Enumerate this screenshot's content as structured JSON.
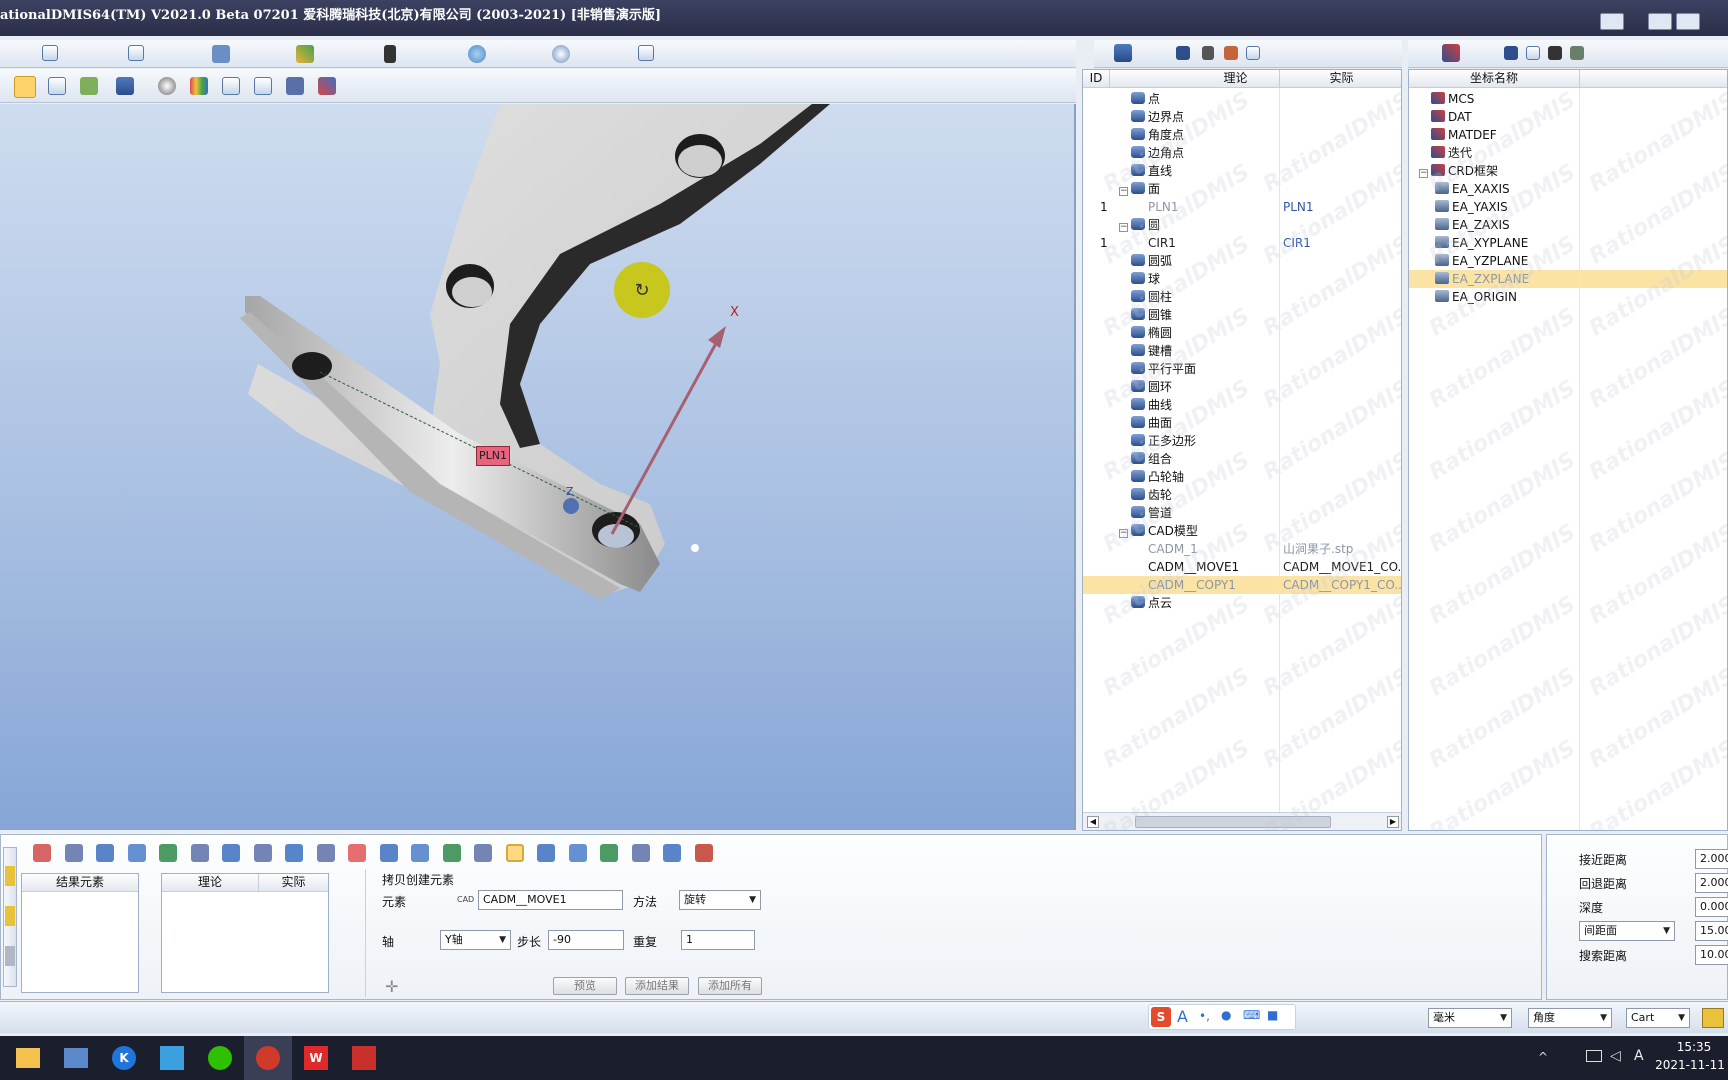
{
  "window": {
    "title": "ationalDMIS64(TM) V2021.0 Beta 07201   爱科腾瑞科技(北京)有限公司 (2003-2021) [非销售演示版]"
  },
  "viewport": {
    "plane_label": "PLN1",
    "axis_x_label": "X",
    "axis_z_label": "Z"
  },
  "feature_tree": {
    "headers": [
      "ID",
      "理论",
      "实际"
    ],
    "rows": [
      {
        "id": "",
        "name": "点",
        "actual": "",
        "icon": "point-icon",
        "level": 1
      },
      {
        "id": "",
        "name": "边界点",
        "actual": "",
        "icon": "edge-point-icon",
        "level": 1
      },
      {
        "id": "",
        "name": "角度点",
        "actual": "",
        "icon": "angle-point-icon",
        "level": 1
      },
      {
        "id": "",
        "name": "边角点",
        "actual": "",
        "icon": "corner-point-icon",
        "level": 1
      },
      {
        "id": "",
        "name": "直线",
        "actual": "",
        "icon": "line-icon",
        "level": 1
      },
      {
        "id": "",
        "name": "面",
        "actual": "",
        "icon": "plane-icon",
        "level": 1,
        "expanded": true
      },
      {
        "id": "1",
        "name": "PLN1",
        "actual": "PLN1",
        "icon": "",
        "level": 2,
        "dim": true
      },
      {
        "id": "",
        "name": "圆",
        "actual": "",
        "icon": "circle-icon",
        "level": 1,
        "expanded": true
      },
      {
        "id": "1",
        "name": "CIR1",
        "actual": "CIR1",
        "icon": "",
        "level": 2
      },
      {
        "id": "",
        "name": "圆弧",
        "actual": "",
        "icon": "arc-icon",
        "level": 1
      },
      {
        "id": "",
        "name": "球",
        "actual": "",
        "icon": "sphere-icon",
        "level": 1
      },
      {
        "id": "",
        "name": "圆柱",
        "actual": "",
        "icon": "cylinder-icon",
        "level": 1
      },
      {
        "id": "",
        "name": "圆锥",
        "actual": "",
        "icon": "cone-icon",
        "level": 1
      },
      {
        "id": "",
        "name": "椭圆",
        "actual": "",
        "icon": "ellipse-icon",
        "level": 1
      },
      {
        "id": "",
        "name": "键槽",
        "actual": "",
        "icon": "slot-icon",
        "level": 1
      },
      {
        "id": "",
        "name": "平行平面",
        "actual": "",
        "icon": "parallel-plane-icon",
        "level": 1
      },
      {
        "id": "",
        "name": "圆环",
        "actual": "",
        "icon": "torus-icon",
        "level": 1
      },
      {
        "id": "",
        "name": "曲线",
        "actual": "",
        "icon": "curve-icon",
        "level": 1
      },
      {
        "id": "",
        "name": "曲面",
        "actual": "",
        "icon": "surface-icon",
        "level": 1
      },
      {
        "id": "",
        "name": "正多边形",
        "actual": "",
        "icon": "polygon-icon",
        "level": 1
      },
      {
        "id": "",
        "name": "组合",
        "actual": "",
        "icon": "compound-icon",
        "level": 1
      },
      {
        "id": "",
        "name": "凸轮轴",
        "actual": "",
        "icon": "camshaft-icon",
        "level": 1
      },
      {
        "id": "",
        "name": "齿轮",
        "actual": "",
        "icon": "gear-icon",
        "level": 1
      },
      {
        "id": "",
        "name": "管道",
        "actual": "",
        "icon": "pipe-icon",
        "level": 1
      },
      {
        "id": "",
        "name": "CAD模型",
        "actual": "",
        "icon": "cad-icon",
        "level": 1,
        "expanded": true
      },
      {
        "id": "",
        "name": "CADM_1",
        "actual": "山涧果子.stp",
        "icon": "",
        "level": 2,
        "dim": true
      },
      {
        "id": "",
        "name": "CADM__MOVE1",
        "actual": "CADM__MOVE1_CO...",
        "icon": "",
        "level": 2
      },
      {
        "id": "",
        "name": "CADM__COPY1",
        "actual": "CADM__COPY1_CO...",
        "icon": "",
        "level": 2,
        "dim": true,
        "selected": true
      },
      {
        "id": "",
        "name": "点云",
        "actual": "",
        "icon": "point-cloud-icon",
        "level": 1
      }
    ]
  },
  "coord_tree": {
    "header": "坐标名称",
    "rows": [
      {
        "name": "MCS",
        "level": 1
      },
      {
        "name": "DAT",
        "level": 1
      },
      {
        "name": "MATDEF",
        "level": 1
      },
      {
        "name": "迭代",
        "level": 1
      },
      {
        "name": "CRD框架",
        "level": 1,
        "expanded": true
      },
      {
        "name": "EA_XAXIS",
        "level": 2
      },
      {
        "name": "EA_YAXIS",
        "level": 2
      },
      {
        "name": "EA_ZAXIS",
        "level": 2
      },
      {
        "name": "EA_XYPLANE",
        "level": 2
      },
      {
        "name": "EA_YZPLANE",
        "level": 2
      },
      {
        "name": "EA_ZXPLANE",
        "level": 2,
        "selected": true
      },
      {
        "name": "EA_ORIGIN",
        "level": 2
      }
    ]
  },
  "copy_panel": {
    "result_header": "结果元素",
    "theory_header": "理论",
    "actual_header": "实际",
    "section_title": "拷贝创建元素",
    "element_label": "元素",
    "element_prefix": "CAD",
    "element_value": "CADM__MOVE1",
    "method_label": "方法",
    "method_value": "旋转",
    "axis_label": "轴",
    "axis_value": "Y轴",
    "step_label": "步长",
    "step_value": "-90",
    "repeat_label": "重复",
    "repeat_value": "1",
    "preview_button": "预览",
    "add_result_button": "添加结果",
    "add_all_button": "添加所有"
  },
  "probe_params": {
    "approach_label": "接近距离",
    "approach_value": "2.000",
    "retract_label": "回退距离",
    "retract_value": "2.000",
    "depth_label": "深度",
    "depth_value": "0.000",
    "spacing_combo": "间距面",
    "spacing_value": "15.00",
    "search_label": "搜索距离",
    "search_value": "10.00"
  },
  "status": {
    "unit": "毫米",
    "angle": "角度",
    "coord": "Cart"
  },
  "taskbar": {
    "time": "15:35",
    "date": "2021-11-11",
    "ime": "A"
  }
}
